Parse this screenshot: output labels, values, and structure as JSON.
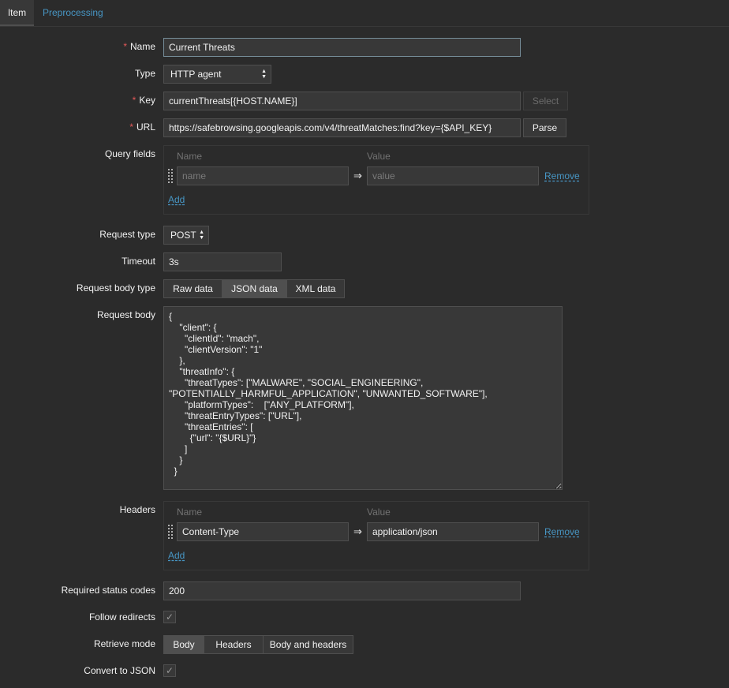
{
  "tabs": [
    {
      "label": "Item",
      "active": true
    },
    {
      "label": "Preprocessing",
      "active": false
    }
  ],
  "required_marker": "*",
  "name": {
    "label": "Name",
    "value": "Current Threats"
  },
  "type": {
    "label": "Type",
    "value": "HTTP agent"
  },
  "key": {
    "label": "Key",
    "value": "currentThreats[{HOST.NAME}]",
    "select_button": "Select"
  },
  "url": {
    "label": "URL",
    "value": "https://safebrowsing.googleapis.com/v4/threatMatches:find?key={$API_KEY}",
    "parse_button": "Parse"
  },
  "query_fields": {
    "label": "Query fields",
    "col_name": "Name",
    "col_value": "Value",
    "row": {
      "name_placeholder": "name",
      "value_placeholder": "value",
      "arrow": "⇒",
      "remove": "Remove"
    },
    "add": "Add"
  },
  "request_type": {
    "label": "Request type",
    "value": "POST"
  },
  "timeout": {
    "label": "Timeout",
    "value": "3s"
  },
  "request_body_type": {
    "label": "Request body type",
    "options": [
      "Raw data",
      "JSON data",
      "XML data"
    ],
    "selected": "JSON data"
  },
  "request_body": {
    "label": "Request body",
    "value": "{\n    \"client\": {\n      \"clientId\": \"mach\",\n      \"clientVersion\": \"1\"\n    },\n    \"threatInfo\": {\n      \"threatTypes\": [\"MALWARE\", \"SOCIAL_ENGINEERING\",\n\"POTENTIALLY_HARMFUL_APPLICATION\", \"UNWANTED_SOFTWARE\"],\n      \"platformTypes\":    [\"ANY_PLATFORM\"],\n      \"threatEntryTypes\": [\"URL\"],\n      \"threatEntries\": [\n        {\"url\": \"{$URL}\"}\n      ]\n    }\n  }"
  },
  "headers": {
    "label": "Headers",
    "col_name": "Name",
    "col_value": "Value",
    "row": {
      "name": "Content-Type",
      "value": "application/json",
      "arrow": "⇒",
      "remove": "Remove"
    },
    "add": "Add"
  },
  "status_codes": {
    "label": "Required status codes",
    "value": "200"
  },
  "follow_redirects": {
    "label": "Follow redirects",
    "checked": true
  },
  "retrieve_mode": {
    "label": "Retrieve mode",
    "options": [
      "Body",
      "Headers",
      "Body and headers"
    ],
    "selected": "Body"
  },
  "convert_json": {
    "label": "Convert to JSON",
    "checked": true
  },
  "colors": {
    "background": "#2b2b2b",
    "input_bg": "#383838",
    "border": "#4f4f4f",
    "link": "#4796c4",
    "required": "#e45959"
  }
}
